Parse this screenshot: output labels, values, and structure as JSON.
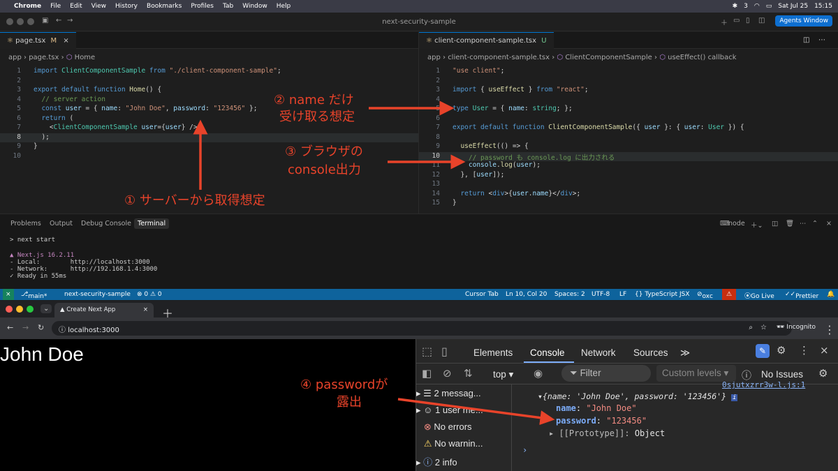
{
  "menubar": {
    "app": "Chrome",
    "items": [
      "File",
      "Edit",
      "View",
      "History",
      "Bookmarks",
      "Profiles",
      "Tab",
      "Window",
      "Help"
    ],
    "badge": "3",
    "date": "Sat Jul 25",
    "time": "15:15"
  },
  "window": {
    "title": "next-security-sample",
    "agents_button": "Agents Window"
  },
  "left_editor": {
    "tab": "page.tsx",
    "tab_flag": "M",
    "breadcrumb": [
      "app",
      "page.tsx",
      "Home"
    ],
    "lines": [
      {
        "n": "1",
        "html": "<span class='k'>import</span> <span class='t'>ClientComponentSample</span> <span class='k'>from</span> <span class='s'>\"./client-component-sample\"</span>;"
      },
      {
        "n": "2",
        "html": ""
      },
      {
        "n": "3",
        "html": "<span class='k'>export default function</span> <span class='f'>Home</span>() {"
      },
      {
        "n": "4",
        "html": "  <span class='c'>// server action</span>"
      },
      {
        "n": "5",
        "html": "  <span class='k'>const</span> <span class='v'>user</span> = { <span class='v'>name</span>: <span class='s'>\"John Doe\"</span>, <span class='v'>password</span>: <span class='s'>\"123456\"</span> };"
      },
      {
        "n": "6",
        "html": "  <span class='k'>return</span> ("
      },
      {
        "n": "7",
        "html": "    &lt;<span class='t'>ClientComponentSample</span> <span class='v'>user</span>={<span class='v'>user</span>} /&gt;"
      },
      {
        "n": "8",
        "html": "  );"
      },
      {
        "n": "9",
        "html": "}"
      },
      {
        "n": "10",
        "html": ""
      }
    ]
  },
  "right_editor": {
    "tab": "client-component-sample.tsx",
    "tab_flag": "U",
    "breadcrumb": [
      "app",
      "client-component-sample.tsx",
      "ClientComponentSample",
      "useEffect() callback"
    ],
    "lines": [
      {
        "n": "1",
        "html": "<span class='s'>\"use client\"</span>;"
      },
      {
        "n": "2",
        "html": ""
      },
      {
        "n": "3",
        "html": "<span class='k'>import</span> { <span class='f'>useEffect</span> } <span class='k'>from</span> <span class='s'>\"react\"</span>;"
      },
      {
        "n": "4",
        "html": ""
      },
      {
        "n": "5",
        "html": "<span class='k'>type</span> <span class='t'>User</span> = { <span class='v'>name</span>: <span class='t'>string</span>; };"
      },
      {
        "n": "6",
        "html": ""
      },
      {
        "n": "7",
        "html": "<span class='k'>export default function</span> <span class='f'>ClientComponentSample</span>({ <span class='v'>user</span> }: { <span class='v'>user</span>: <span class='t'>User</span> }) {"
      },
      {
        "n": "8",
        "html": ""
      },
      {
        "n": "9",
        "html": "  <span class='f'>useEffect</span>(() =&gt; {"
      },
      {
        "n": "10",
        "html": "    <span class='c'>// password も console.log に出力される</span>"
      },
      {
        "n": "11",
        "html": "    <span class='v'>console</span>.<span class='f'>log</span>(<span class='v'>user</span>);"
      },
      {
        "n": "12",
        "html": "  }, [<span class='v'>user</span>]);"
      },
      {
        "n": "13",
        "html": ""
      },
      {
        "n": "14",
        "html": "  <span class='k'>return</span> &lt;<span class='k'>div</span>&gt;{<span class='v'>user</span>.<span class='v'>name</span>}&lt;/<span class='k'>div</span>&gt;;"
      },
      {
        "n": "15",
        "html": "}"
      }
    ]
  },
  "panel": {
    "tabs": [
      "Problems",
      "Output",
      "Debug Console",
      "Terminal"
    ],
    "shell": "node",
    "terminal": [
      "> next start",
      "",
      "▲ Next.js 16.2.11",
      "- Local:        http://localhost:3000",
      "- Network:      http://192.168.1.4:3000",
      "✓ Ready in 55ms"
    ]
  },
  "statusbar": {
    "branch": "main*",
    "repo": "next-security-sample",
    "problems": "⊗ 0 ⚠ 0",
    "cursor_tab": "Cursor Tab",
    "position": "Ln 10, Col 20",
    "spaces": "Spaces: 2",
    "encoding": "UTF-8",
    "eol": "LF",
    "language": "{} TypeScript JSX",
    "oxc": "oxc",
    "golive": "Go Live",
    "prettier": "Prettier"
  },
  "browser": {
    "tab_title": "Create Next App",
    "url": "localhost:3000",
    "incognito": "Incognito",
    "page_text": "John Doe"
  },
  "devtools": {
    "tabs": [
      "Elements",
      "Console",
      "Network",
      "Sources"
    ],
    "context": "top",
    "filter_placeholder": "Filter",
    "levels": "Custom levels",
    "issues": "No Issues",
    "sidebar": [
      "2 messag...",
      "1 user me...",
      "No errors",
      "No warnin...",
      "2 info"
    ],
    "source_link": "0sjutxzrr3w-l.js:1",
    "log_summary": "{name: 'John Doe', password: '123456'}",
    "name_key": "name",
    "name_val": "\"John Doe\"",
    "password_key": "password",
    "password_val": "\"123456\"",
    "proto": "[[Prototype]]",
    "proto_val": "Object"
  },
  "annotations": {
    "a1": "① サーバーから取得想定",
    "a2_l1": "② name だけ",
    "a2_l2": "受け取る想定",
    "a3_l1": "③ ブラウザの",
    "a3_l2": "console出力",
    "a4_l1": "④ passwordが",
    "a4_l2": "露出"
  },
  "accent": {
    "red": "#e8432a",
    "blue": "#0e639c",
    "active_tab": "#0078d4"
  }
}
